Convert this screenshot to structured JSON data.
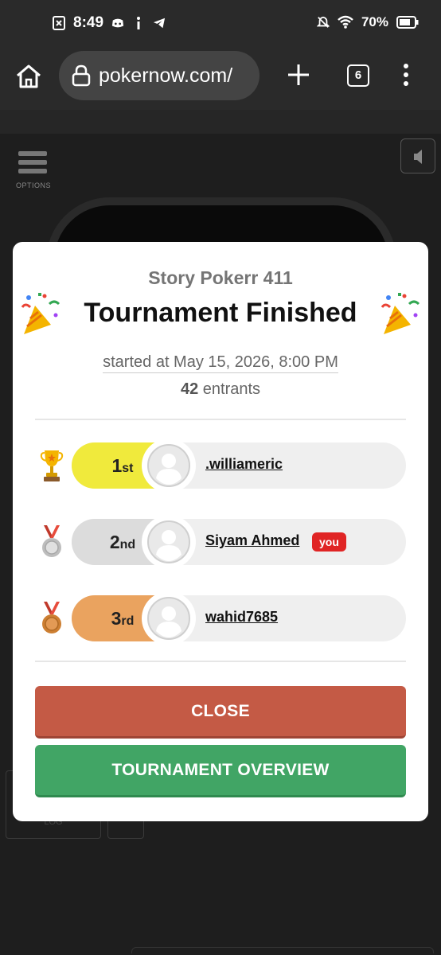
{
  "status_bar": {
    "time": "8:49",
    "battery": "70%"
  },
  "browser": {
    "url": "pokernow.com/",
    "tab_count": "6"
  },
  "game": {
    "options_label": "OPTIONS",
    "log_label": "LOG"
  },
  "modal": {
    "game_name": "Story Pokerr 411",
    "title": "Tournament Finished",
    "started_at": "started at May 15, 2026, 8:00 PM",
    "entrants_count": "42",
    "entrants_label": "entrants",
    "results": [
      {
        "place": "1",
        "suffix": "st",
        "name": ".williameric",
        "medal": "trophy-icon",
        "color": "#f0ea3c",
        "is_you": false
      },
      {
        "place": "2",
        "suffix": "nd",
        "name": "Siyam Ahmed",
        "medal": "silver-medal-icon",
        "color": "#dcdcdc",
        "is_you": true,
        "you_label": "you"
      },
      {
        "place": "3",
        "suffix": "rd",
        "name": "wahid7685",
        "medal": "bronze-medal-icon",
        "color": "#eaa35f",
        "is_you": false
      }
    ],
    "close_button": "CLOSE",
    "overview_button": "TOURNAMENT OVERVIEW"
  }
}
